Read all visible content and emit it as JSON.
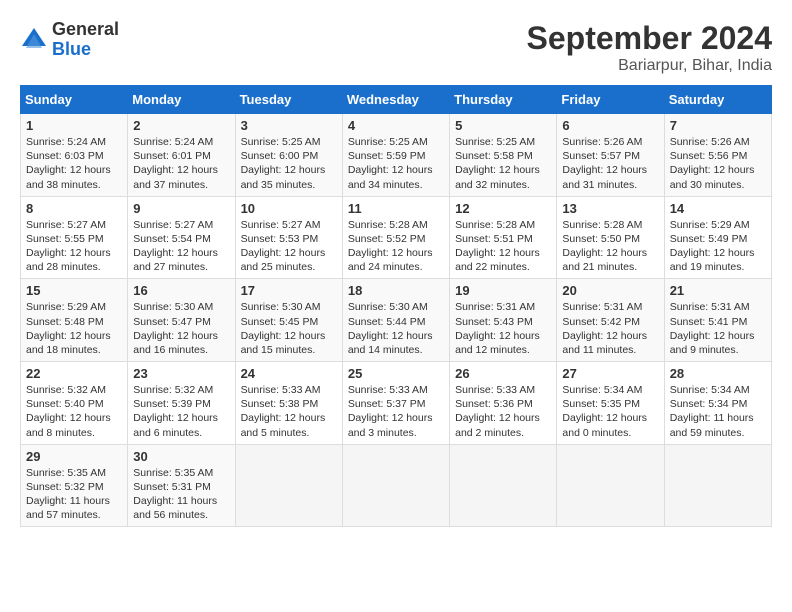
{
  "header": {
    "logo_general": "General",
    "logo_blue": "Blue",
    "month_year": "September 2024",
    "location": "Bariarpur, Bihar, India"
  },
  "weekdays": [
    "Sunday",
    "Monday",
    "Tuesday",
    "Wednesday",
    "Thursday",
    "Friday",
    "Saturday"
  ],
  "weeks": [
    [
      {
        "day": "1",
        "sunrise": "5:24 AM",
        "sunset": "6:03 PM",
        "daylight": "12 hours and 38 minutes."
      },
      {
        "day": "2",
        "sunrise": "5:24 AM",
        "sunset": "6:01 PM",
        "daylight": "12 hours and 37 minutes."
      },
      {
        "day": "3",
        "sunrise": "5:25 AM",
        "sunset": "6:00 PM",
        "daylight": "12 hours and 35 minutes."
      },
      {
        "day": "4",
        "sunrise": "5:25 AM",
        "sunset": "5:59 PM",
        "daylight": "12 hours and 34 minutes."
      },
      {
        "day": "5",
        "sunrise": "5:25 AM",
        "sunset": "5:58 PM",
        "daylight": "12 hours and 32 minutes."
      },
      {
        "day": "6",
        "sunrise": "5:26 AM",
        "sunset": "5:57 PM",
        "daylight": "12 hours and 31 minutes."
      },
      {
        "day": "7",
        "sunrise": "5:26 AM",
        "sunset": "5:56 PM",
        "daylight": "12 hours and 30 minutes."
      }
    ],
    [
      {
        "day": "8",
        "sunrise": "5:27 AM",
        "sunset": "5:55 PM",
        "daylight": "12 hours and 28 minutes."
      },
      {
        "day": "9",
        "sunrise": "5:27 AM",
        "sunset": "5:54 PM",
        "daylight": "12 hours and 27 minutes."
      },
      {
        "day": "10",
        "sunrise": "5:27 AM",
        "sunset": "5:53 PM",
        "daylight": "12 hours and 25 minutes."
      },
      {
        "day": "11",
        "sunrise": "5:28 AM",
        "sunset": "5:52 PM",
        "daylight": "12 hours and 24 minutes."
      },
      {
        "day": "12",
        "sunrise": "5:28 AM",
        "sunset": "5:51 PM",
        "daylight": "12 hours and 22 minutes."
      },
      {
        "day": "13",
        "sunrise": "5:28 AM",
        "sunset": "5:50 PM",
        "daylight": "12 hours and 21 minutes."
      },
      {
        "day": "14",
        "sunrise": "5:29 AM",
        "sunset": "5:49 PM",
        "daylight": "12 hours and 19 minutes."
      }
    ],
    [
      {
        "day": "15",
        "sunrise": "5:29 AM",
        "sunset": "5:48 PM",
        "daylight": "12 hours and 18 minutes."
      },
      {
        "day": "16",
        "sunrise": "5:30 AM",
        "sunset": "5:47 PM",
        "daylight": "12 hours and 16 minutes."
      },
      {
        "day": "17",
        "sunrise": "5:30 AM",
        "sunset": "5:45 PM",
        "daylight": "12 hours and 15 minutes."
      },
      {
        "day": "18",
        "sunrise": "5:30 AM",
        "sunset": "5:44 PM",
        "daylight": "12 hours and 14 minutes."
      },
      {
        "day": "19",
        "sunrise": "5:31 AM",
        "sunset": "5:43 PM",
        "daylight": "12 hours and 12 minutes."
      },
      {
        "day": "20",
        "sunrise": "5:31 AM",
        "sunset": "5:42 PM",
        "daylight": "12 hours and 11 minutes."
      },
      {
        "day": "21",
        "sunrise": "5:31 AM",
        "sunset": "5:41 PM",
        "daylight": "12 hours and 9 minutes."
      }
    ],
    [
      {
        "day": "22",
        "sunrise": "5:32 AM",
        "sunset": "5:40 PM",
        "daylight": "12 hours and 8 minutes."
      },
      {
        "day": "23",
        "sunrise": "5:32 AM",
        "sunset": "5:39 PM",
        "daylight": "12 hours and 6 minutes."
      },
      {
        "day": "24",
        "sunrise": "5:33 AM",
        "sunset": "5:38 PM",
        "daylight": "12 hours and 5 minutes."
      },
      {
        "day": "25",
        "sunrise": "5:33 AM",
        "sunset": "5:37 PM",
        "daylight": "12 hours and 3 minutes."
      },
      {
        "day": "26",
        "sunrise": "5:33 AM",
        "sunset": "5:36 PM",
        "daylight": "12 hours and 2 minutes."
      },
      {
        "day": "27",
        "sunrise": "5:34 AM",
        "sunset": "5:35 PM",
        "daylight": "12 hours and 0 minutes."
      },
      {
        "day": "28",
        "sunrise": "5:34 AM",
        "sunset": "5:34 PM",
        "daylight": "11 hours and 59 minutes."
      }
    ],
    [
      {
        "day": "29",
        "sunrise": "5:35 AM",
        "sunset": "5:32 PM",
        "daylight": "11 hours and 57 minutes."
      },
      {
        "day": "30",
        "sunrise": "5:35 AM",
        "sunset": "5:31 PM",
        "daylight": "11 hours and 56 minutes."
      },
      null,
      null,
      null,
      null,
      null
    ]
  ],
  "labels": {
    "sunrise": "Sunrise: ",
    "sunset": "Sunset: ",
    "daylight": "Daylight: "
  }
}
